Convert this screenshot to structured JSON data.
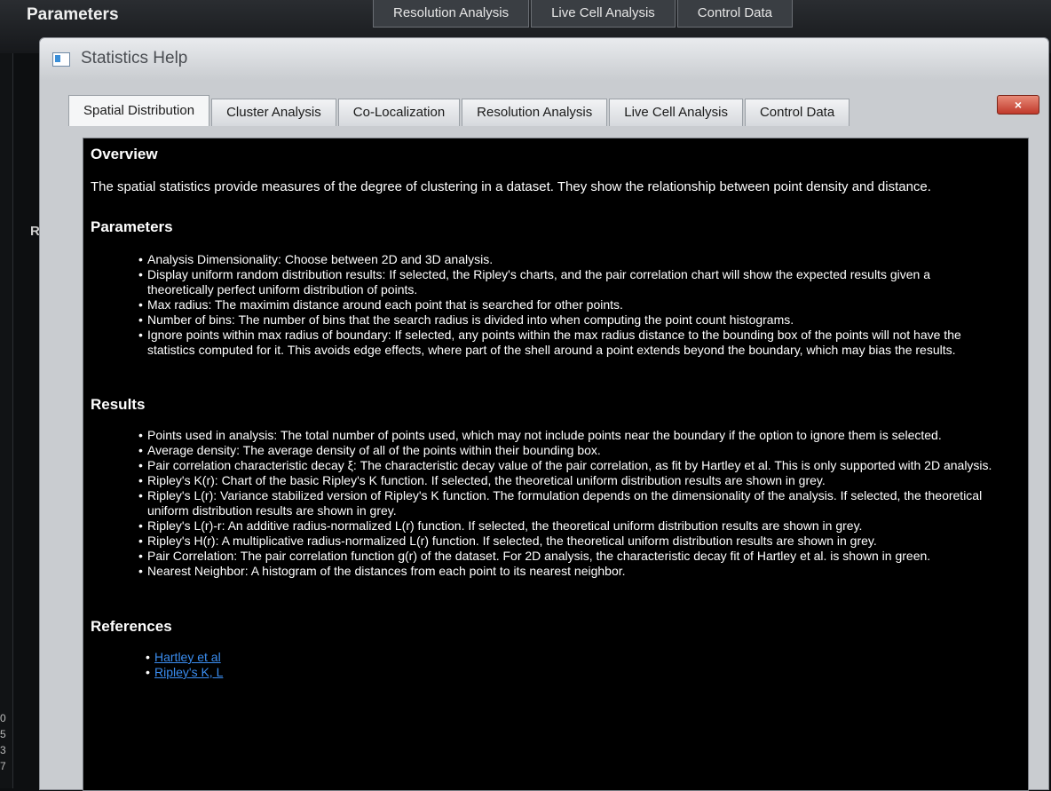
{
  "background": {
    "app_title": "Parameters",
    "tabs": [
      "Resolution Analysis",
      "Live Cell Analysis",
      "Control Data"
    ],
    "side_letter": "R",
    "edge_digits": [
      "0",
      "5",
      "3",
      "7"
    ]
  },
  "window": {
    "title": "Statistics Help",
    "close_symbol": "×"
  },
  "tabs": [
    {
      "label": "Spatial Distribution",
      "active": true
    },
    {
      "label": "Cluster Analysis",
      "active": false
    },
    {
      "label": "Co-Localization",
      "active": false
    },
    {
      "label": "Resolution Analysis",
      "active": false
    },
    {
      "label": "Live Cell Analysis",
      "active": false
    },
    {
      "label": "Control Data",
      "active": false
    }
  ],
  "overview": {
    "heading": "Overview",
    "text": "The spatial statistics provide measures of the degree of clustering in a dataset.  They show the relationship between point density and distance."
  },
  "parameters": {
    "heading": "Parameters",
    "items": [
      "Analysis Dimensionality: Choose between 2D and 3D analysis.",
      "Display uniform random distribution results: If selected, the Ripley's charts, and the pair correlation chart will show the expected results given a theoretically perfect uniform distribution of points.",
      "Max radius: The maximim distance around each point that is searched for other points.",
      "Number of bins: The number of bins that the search radius is divided into when computing the point count histograms.",
      "Ignore points within max radius of boundary: If selected, any points within the max radius distance to the bounding box of the points will not have the statistics computed for it. This avoids edge effects, where part of the shell around a point extends beyond the boundary, which may bias the results."
    ]
  },
  "results": {
    "heading": "Results",
    "items": [
      "Points used in analysis: The total number of points used, which may not include points near the boundary if the option to ignore them is selected.",
      "Average density:  The average density of all of the points within their bounding box.",
      "Pair correlation characteristic decay ξ: The characteristic decay value of the pair correlation, as fit by Hartley et al.  This is only supported with 2D analysis.",
      "Ripley's K(r): Chart of the basic Ripley's K function.  If selected, the theoretical uniform distribution results are shown in grey.",
      "Ripley's L(r): Variance stabilized version of Ripley's K function.  The formulation depends on the dimensionality of the analysis. If selected, the theoretical uniform distribution results are shown in grey.",
      "Ripley's L(r)-r: An additive radius-normalized L(r) function.  If selected, the theoretical uniform distribution results are shown in grey.",
      "Ripley's H(r): A multiplicative radius-normalized L(r) function. If selected, the theoretical uniform distribution results are shown in grey.",
      "Pair Correlation: The pair correlation function g(r) of the dataset.  For 2D analysis, the characteristic decay fit of Hartley et al. is shown in green.",
      "Nearest Neighbor: A histogram of the distances from each point to its nearest neighbor."
    ]
  },
  "references": {
    "heading": "References",
    "links": [
      "Hartley et al",
      "Ripley's K, L"
    ]
  },
  "colors": {
    "content_bg": "#000000",
    "link": "#3a8df0",
    "close_button": "#c0392b"
  }
}
